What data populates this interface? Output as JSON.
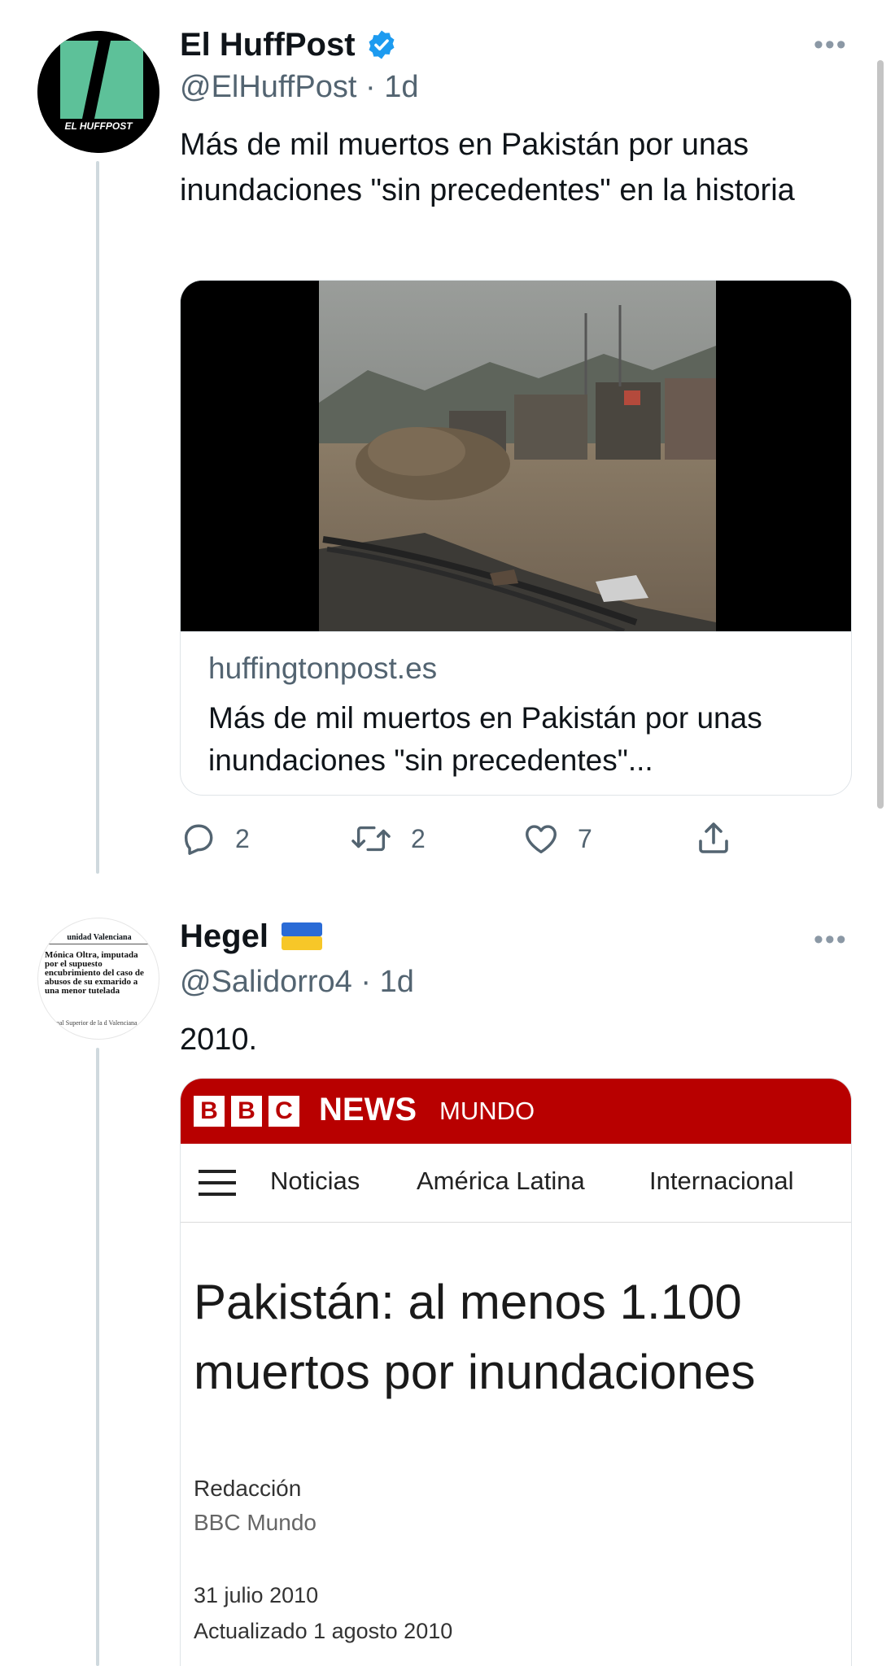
{
  "tweet1": {
    "avatar_text": "EL HUFFPOST",
    "name": "El HuffPost",
    "verified": true,
    "handle": "@ElHuffPost",
    "time_sep": " · ",
    "time": "1d",
    "text": "Más de mil muertos en Pakistán por unas inundaciones \"sin precedentes\" en la historia",
    "card": {
      "domain": "huffingtonpost.es",
      "title": "Más de mil muertos en Pakistán por unas inundaciones \"sin precedentes\"..."
    },
    "actions": {
      "replies": "2",
      "retweets": "2",
      "likes": "7"
    }
  },
  "tweet2": {
    "avatar_text": {
      "header": "unidad Valenciana",
      "headline": "Mónica Oltra, imputada por el supuesto encubrimiento del caso de abusos de su exmarido a una menor tutelada",
      "footer": "bunal Superior de la d Valenciana"
    },
    "name": "Hegel",
    "flag": "🇺🇦",
    "handle": "@Salidorro4",
    "time_sep": " · ",
    "time": "1d",
    "text": "2010.",
    "bbc": {
      "letters": [
        "B",
        "B",
        "C"
      ],
      "news": "NEWS",
      "mundo": "MUNDO",
      "nav": [
        "Noticias",
        "América Latina",
        "Internacional"
      ],
      "headline": "Pakistán: al menos 1.100 muertos por inundaciones",
      "author": "Redacción",
      "outlet": "BBC Mundo",
      "date": "31 julio 2010",
      "updated": "Actualizado 1 agosto 2010"
    }
  },
  "colors": {
    "verified": "#1d9bf0",
    "huffpost_green": "#5dc199",
    "bbc_red": "#b80000",
    "secondary_text": "#536471"
  }
}
